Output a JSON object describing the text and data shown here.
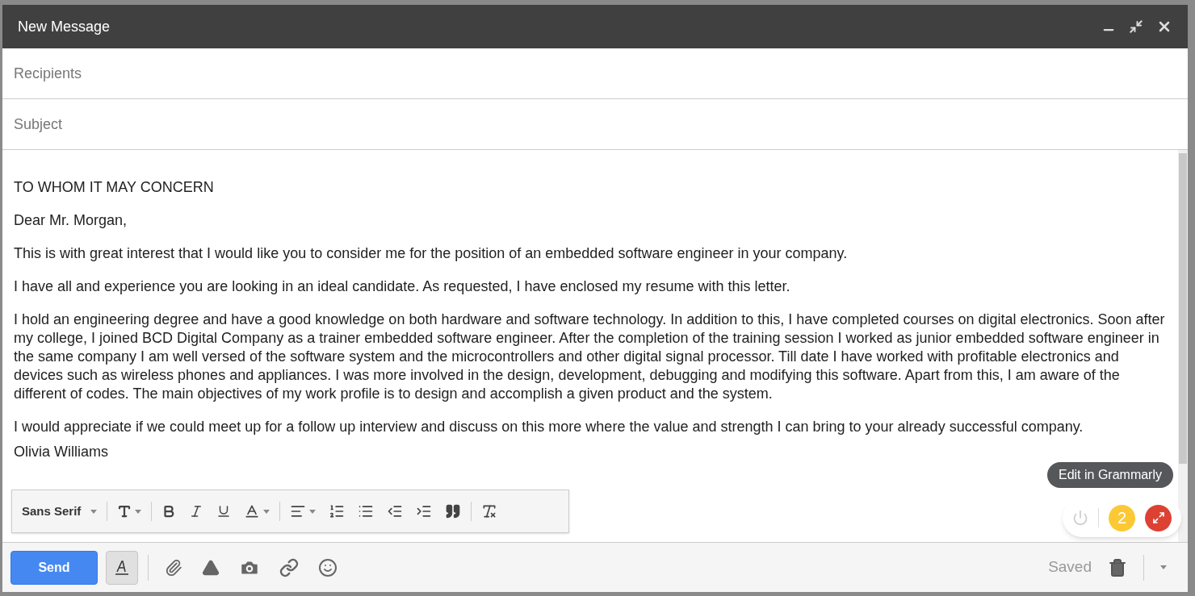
{
  "window": {
    "title": "New Message"
  },
  "recipients": {
    "placeholder": "Recipients"
  },
  "subject": {
    "placeholder": "Subject"
  },
  "body": {
    "paragraphs": [
      "TO WHOM IT MAY CONCERN",
      "Dear Mr. Morgan,",
      "This is with great interest that I would like you to consider me for the position of an embedded software engineer in your company.",
      "I have all and experience you are looking in an ideal candidate. As requested, I have enclosed my resume with this letter.",
      "I hold an engineering degree and have a good knowledge on both hardware and software technology. In addition to this, I have completed courses on digital electronics. Soon after my college, I joined BCD Digital Company as a trainer embedded software engineer. After the completion of the training session I worked as junior embedded software engineer in the same company I am well versed of the software system and the microcontrollers and other digital signal processor. Till date I have worked with profitable electronics and devices such as wireless phones and appliances. I was more involved in the design, development, debugging and modifying this software. Apart from this, I am aware of the different of codes. The main objectives of my work profile is to design and accomplish a given product and the system.",
      "I would appreciate if we could meet up for a follow up interview and discuss on this more where the value and strength I can bring to your already successful company."
    ],
    "signature": "Olivia Williams"
  },
  "format_toolbar": {
    "font": "Sans Serif"
  },
  "bottom_bar": {
    "send": "Send",
    "formatting_selected": true,
    "status": "Saved"
  },
  "grammarly": {
    "tooltip": "Edit in Grammarly",
    "count": "2"
  }
}
